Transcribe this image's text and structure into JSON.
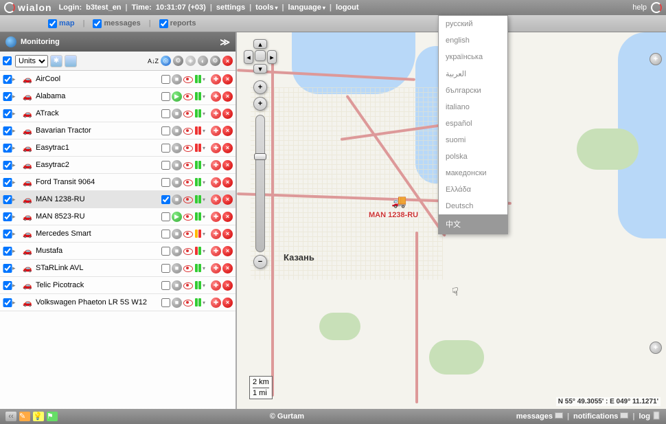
{
  "topbar": {
    "logo_text": "wialon",
    "login_label": "Login:",
    "login_user": "b3test_en",
    "time_label": "Time:",
    "time_value": "10:31:07 (+03)",
    "settings": "settings",
    "tools": "tools",
    "language": "language",
    "logout": "logout",
    "help": "help"
  },
  "tabs": {
    "map": "map",
    "messages": "messages",
    "reports": "reports"
  },
  "panel": {
    "title": "Monitoring",
    "units_label": "Units",
    "sort_label": "A↓Z"
  },
  "units": [
    {
      "name": "AirCool",
      "status": "grey",
      "bars": [
        "g",
        "g"
      ]
    },
    {
      "name": "Alabama",
      "status": "green",
      "bars": [
        "g",
        "g"
      ]
    },
    {
      "name": "ATrack",
      "status": "grey",
      "bars": [
        "g",
        "g"
      ]
    },
    {
      "name": "Bavarian Tractor",
      "status": "grey",
      "bars": [
        "r",
        "r"
      ]
    },
    {
      "name": "Easytrac1",
      "status": "grey",
      "bars": [
        "r",
        "r"
      ]
    },
    {
      "name": "Easytrac2",
      "status": "grey",
      "bars": [
        "g",
        "g"
      ]
    },
    {
      "name": "Ford Transit 9064",
      "status": "grey",
      "bars": [
        "g",
        "g"
      ]
    },
    {
      "name": "MAN 1238-RU",
      "status": "grey",
      "bars": [
        "g",
        "g"
      ],
      "selected": true
    },
    {
      "name": "MAN 8523-RU",
      "status": "green",
      "bars": [
        "g",
        "g"
      ]
    },
    {
      "name": "Mercedes Smart",
      "status": "grey",
      "bars": [
        "y",
        "r"
      ]
    },
    {
      "name": "Mustafa",
      "status": "grey",
      "bars": [
        "r",
        "g"
      ]
    },
    {
      "name": "STaRLink AVL",
      "status": "grey",
      "bars": [
        "g",
        "g"
      ]
    },
    {
      "name": "Telic Picotrack",
      "status": "grey",
      "bars": [
        "g",
        "g"
      ]
    },
    {
      "name": "Volkswagen Phaeton LR 5S W12",
      "status": "grey",
      "bars": [
        "g",
        "g"
      ]
    }
  ],
  "map": {
    "truck_label": "MAN 1238-RU",
    "city": "Казань",
    "scale_km": "2 km",
    "scale_mi": "1 mi",
    "coords": "N 55° 49.3055' : E 049° 11.1271'"
  },
  "languages": [
    "русский",
    "english",
    "українська",
    "العربية",
    "български",
    "italiano",
    "español",
    "suomi",
    "polska",
    "македонски",
    "Ελλάδα",
    "Deutsch",
    "中文"
  ],
  "statusbar": {
    "copyright": "© Gurtam",
    "messages": "messages",
    "notifications": "notifications",
    "log": "log"
  }
}
